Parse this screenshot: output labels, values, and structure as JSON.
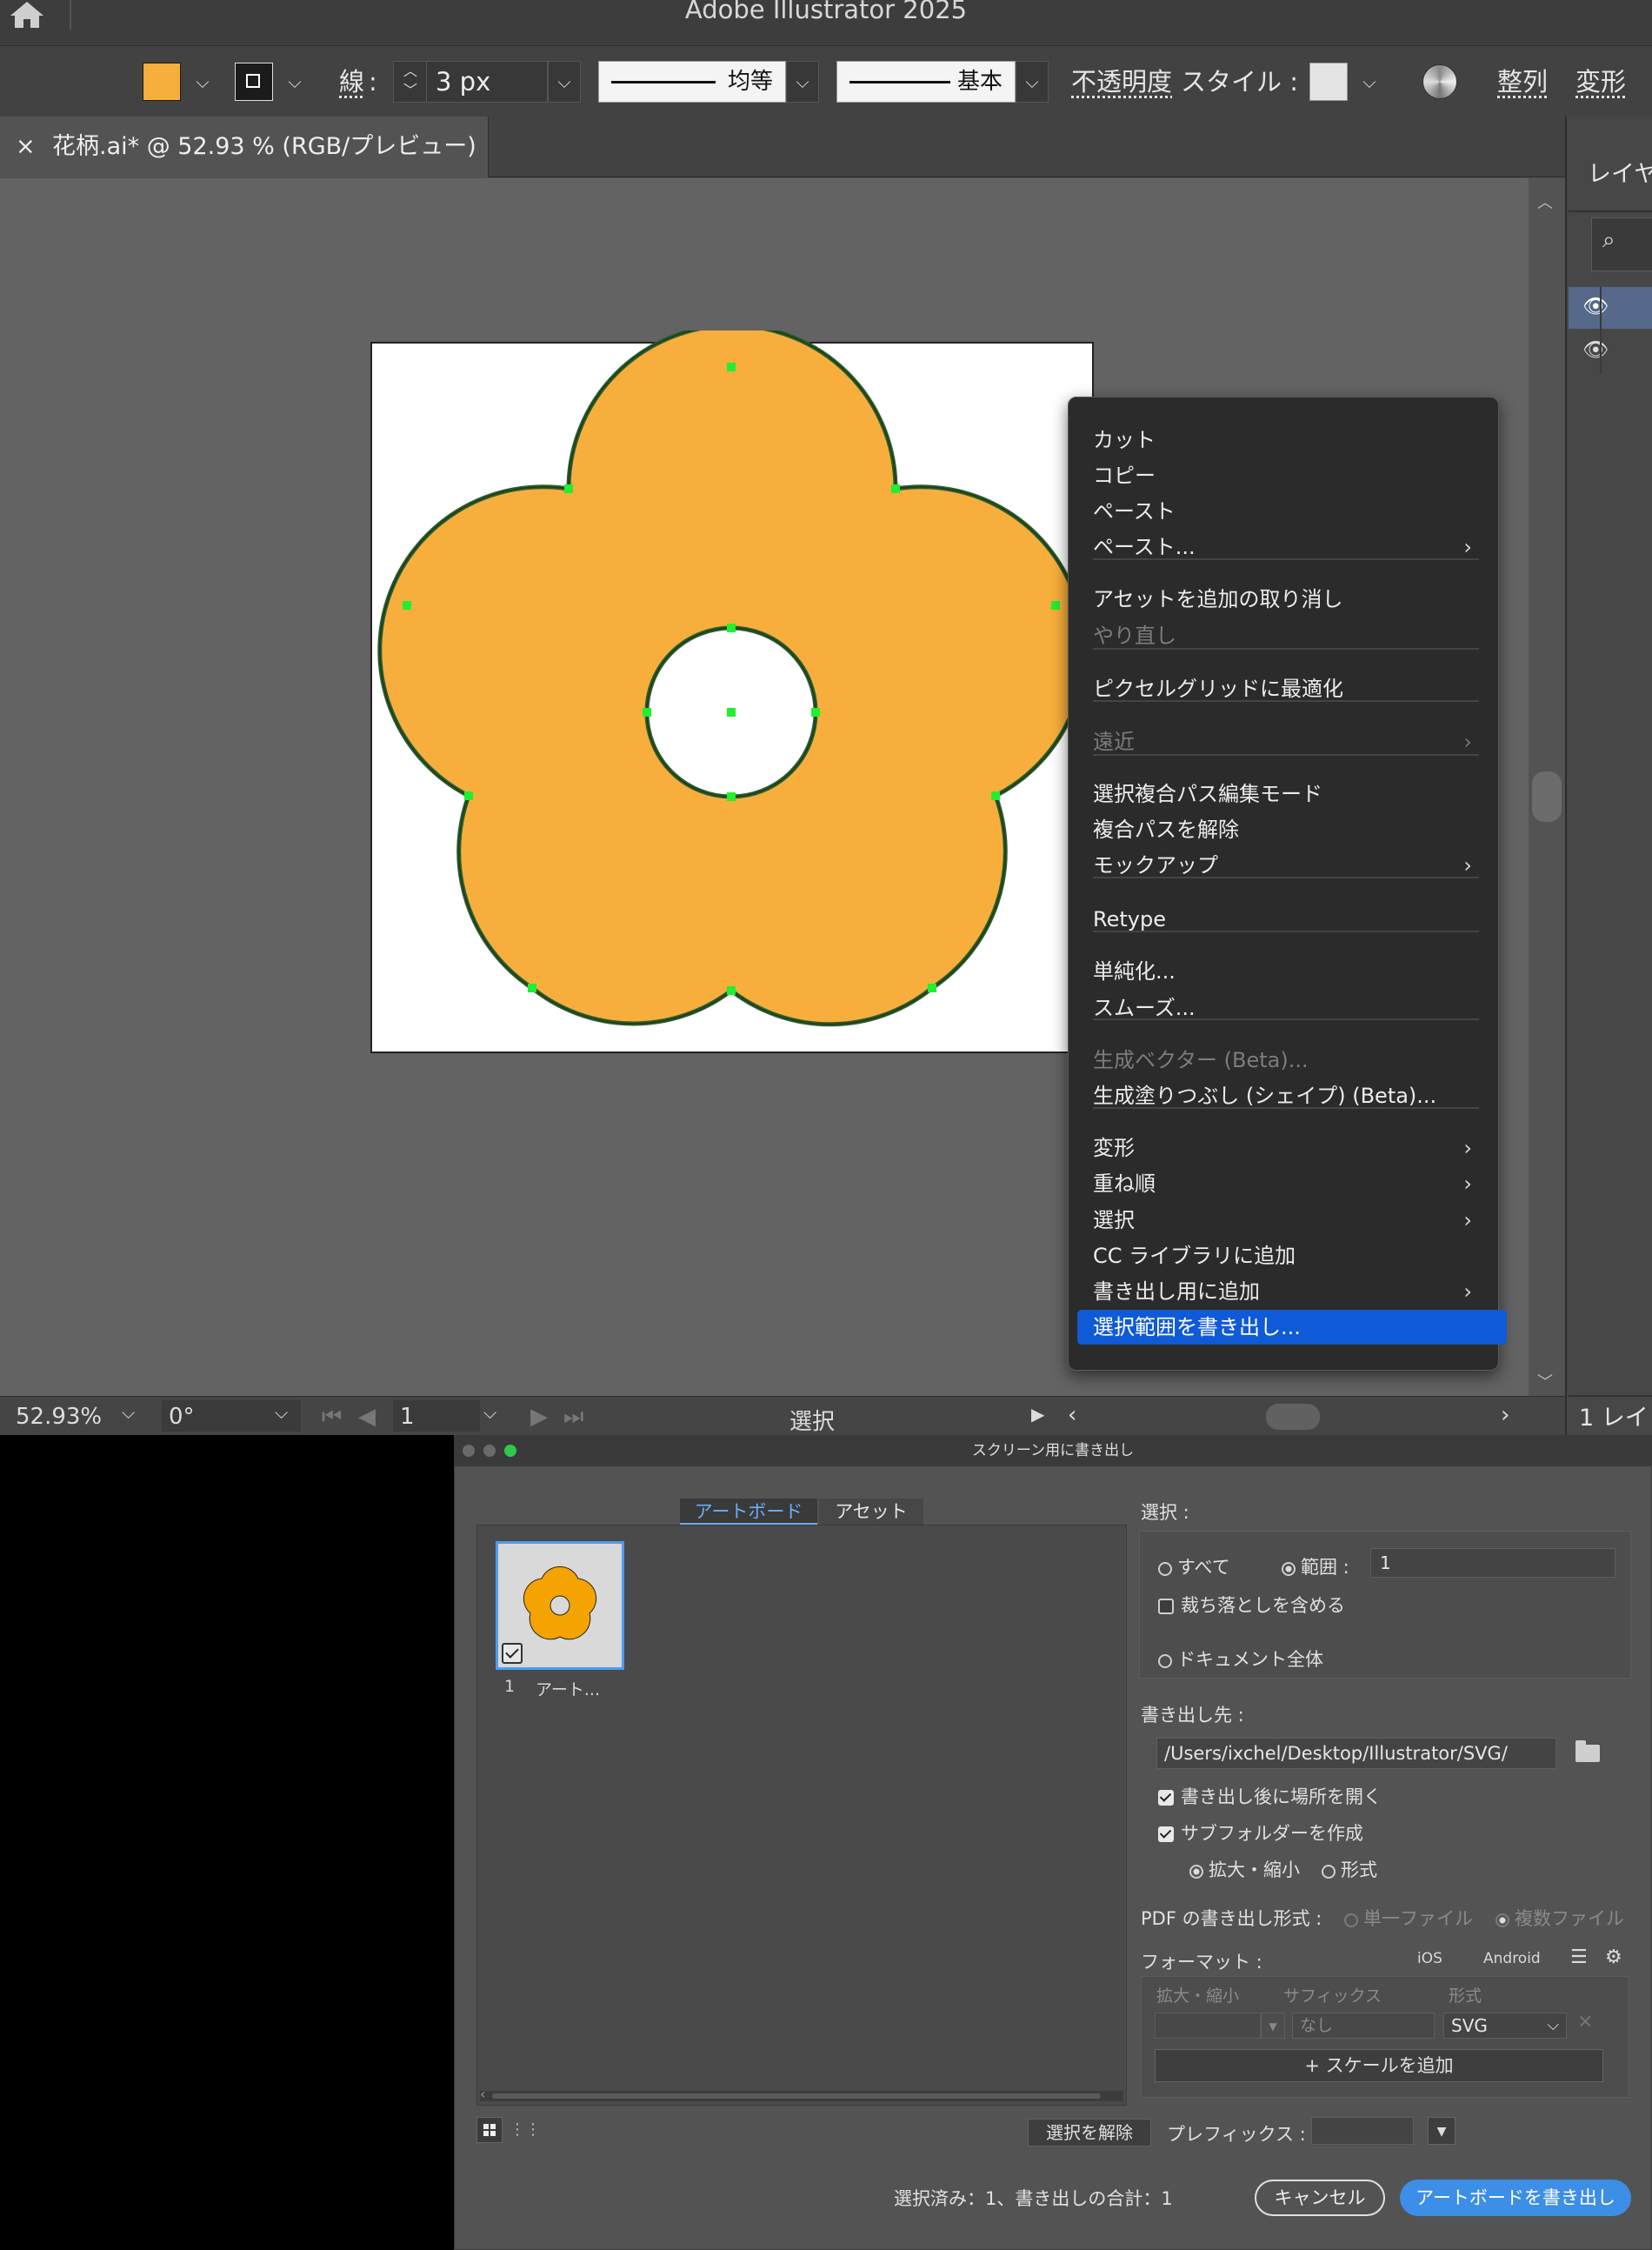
{
  "app": {
    "title": "Adobe Illustrator 2025"
  },
  "control_bar": {
    "fill_color": "#f8ae3c",
    "stroke_label": "線",
    "stroke_colon": ":",
    "stroke_weight": "3 px",
    "profile_label": "均等",
    "brush_label": "基本",
    "opacity_label": "不透明度",
    "style_label": "スタイル :",
    "align_label": "整列",
    "transform_label": "変形"
  },
  "document": {
    "tab_title": "花柄.ai* @ 52.93 % (RGB/プレビュー)",
    "close_glyph": "×",
    "fill_color": "#f8ae3c",
    "stroke_color": "#2d5e2a",
    "anchor_color": "#22ee33"
  },
  "context_menu": {
    "items": [
      {
        "label": "カット",
        "disabled": false,
        "submenu": false
      },
      {
        "label": "コピー",
        "disabled": false,
        "submenu": false
      },
      {
        "label": "ペースト",
        "disabled": false,
        "submenu": false
      },
      {
        "label": "ペースト...",
        "disabled": false,
        "submenu": true
      },
      {
        "label": "アセットを追加の取り消し",
        "disabled": false,
        "submenu": false
      },
      {
        "label": "やり直し",
        "disabled": true,
        "submenu": false
      },
      {
        "label": "ピクセルグリッドに最適化",
        "disabled": false,
        "submenu": false
      },
      {
        "label": "遠近",
        "disabled": true,
        "submenu": true
      },
      {
        "label": "選択複合パス編集モード",
        "disabled": false,
        "submenu": false
      },
      {
        "label": "複合パスを解除",
        "disabled": false,
        "submenu": false
      },
      {
        "label": "モックアップ",
        "disabled": false,
        "submenu": true
      },
      {
        "label": "Retype",
        "disabled": false,
        "submenu": false
      },
      {
        "label": "単純化...",
        "disabled": false,
        "submenu": false
      },
      {
        "label": "スムーズ...",
        "disabled": false,
        "submenu": false
      },
      {
        "label": "生成ベクター (Beta)...",
        "disabled": true,
        "submenu": false
      },
      {
        "label": "生成塗りつぶし (シェイプ) (Beta)...",
        "disabled": false,
        "submenu": false
      },
      {
        "label": "変形",
        "disabled": false,
        "submenu": true
      },
      {
        "label": "重ね順",
        "disabled": false,
        "submenu": true
      },
      {
        "label": "選択",
        "disabled": false,
        "submenu": true
      },
      {
        "label": "CC ライブラリに追加",
        "disabled": false,
        "submenu": false
      },
      {
        "label": "書き出し用に追加",
        "disabled": false,
        "submenu": true
      },
      {
        "label": "選択範囲を書き出し...",
        "disabled": false,
        "submenu": false,
        "highlighted": true
      }
    ]
  },
  "status_bar": {
    "zoom": "52.93%",
    "rotation": "0°",
    "artboard_num": "1",
    "tool": "選択"
  },
  "layers_panel": {
    "title": "レイヤ",
    "footer": "1 レイ"
  },
  "export_dialog": {
    "title": "スクリーン用に書き出し",
    "tab_artboards": "アートボード",
    "tab_assets": "アセット",
    "thumb_num": "1",
    "thumb_name": "アート...",
    "select_label": "選択 :",
    "all_label": "すべて",
    "range_label": "範囲 :",
    "range_value": "1",
    "bleed_label": "裁ち落としを含める",
    "whole_doc_label": "ドキュメント全体",
    "export_to_label": "書き出し先 :",
    "path": "/Users/ixchel/Desktop/Illustrator/SVG/",
    "open_location_label": "書き出し後に場所を開く",
    "subfolder_label": "サブフォルダーを作成",
    "scale_radio": "拡大・縮小",
    "format_radio": "形式",
    "pdf_label": "PDF の書き出し形式 :",
    "single_file": "単一ファイル",
    "multi_file": "複数ファイル",
    "format_label": "フォーマット :",
    "ios": "iOS",
    "android": "Android",
    "col_scale": "拡大・縮小",
    "col_suffix": "サフィックス",
    "col_format": "形式",
    "suffix_placeholder": "なし",
    "format_value": "SVG",
    "add_scale": "+ スケールを追加",
    "deselect": "選択を解除",
    "prefix_label": "プレフィックス :",
    "summary": "選択済み：1、書き出しの合計：1",
    "cancel": "キャンセル",
    "export_button": "アートボードを書き出し"
  }
}
